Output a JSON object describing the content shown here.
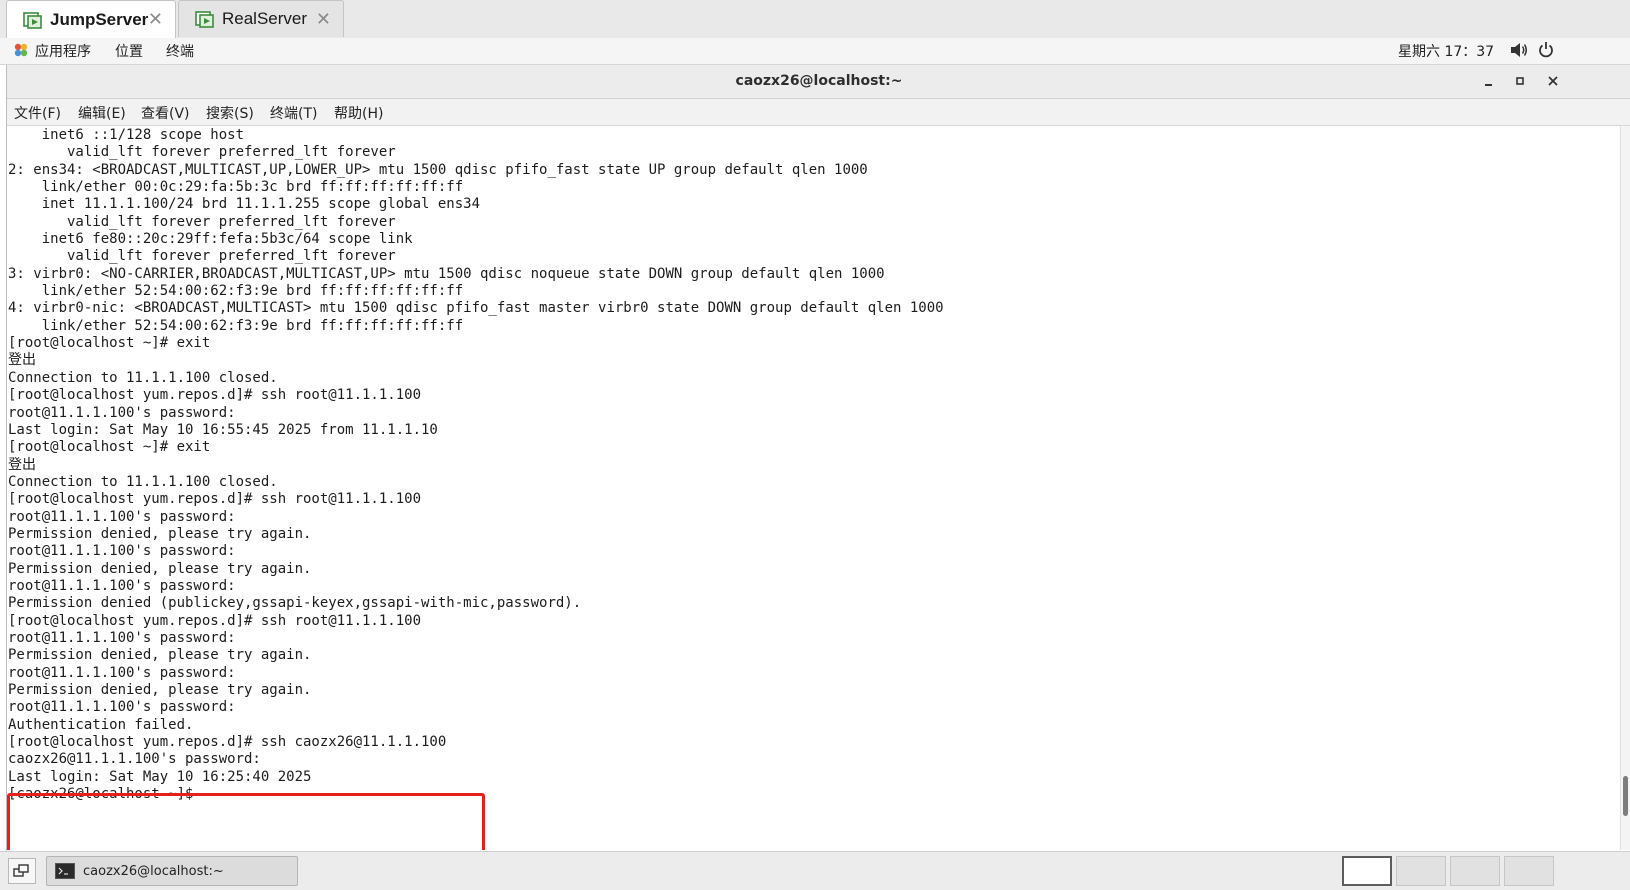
{
  "vm_tabs": [
    {
      "label": "JumpServer",
      "active": true
    },
    {
      "label": "RealServer",
      "active": false
    }
  ],
  "topbar": {
    "apps": "应用程序",
    "places": "位置",
    "terminal": "终端",
    "clock": "星期六 17：37"
  },
  "window": {
    "title": "caozx26@localhost:~"
  },
  "menu": [
    "文件(F)",
    "编辑(E)",
    "查看(V)",
    "搜索(S)",
    "终端(T)",
    "帮助(H)"
  ],
  "terminal": {
    "lines": [
      "    inet6 ::1/128 scope host ",
      "       valid_lft forever preferred_lft forever",
      "2: ens34: <BROADCAST,MULTICAST,UP,LOWER_UP> mtu 1500 qdisc pfifo_fast state UP group default qlen 1000",
      "    link/ether 00:0c:29:fa:5b:3c brd ff:ff:ff:ff:ff:ff",
      "    inet 11.1.1.100/24 brd 11.1.1.255 scope global ens34",
      "       valid_lft forever preferred_lft forever",
      "    inet6 fe80::20c:29ff:fefa:5b3c/64 scope link ",
      "       valid_lft forever preferred_lft forever",
      "3: virbr0: <NO-CARRIER,BROADCAST,MULTICAST,UP> mtu 1500 qdisc noqueue state DOWN group default qlen 1000",
      "    link/ether 52:54:00:62:f3:9e brd ff:ff:ff:ff:ff:ff",
      "4: virbr0-nic: <BROADCAST,MULTICAST> mtu 1500 qdisc pfifo_fast master virbr0 state DOWN group default qlen 1000",
      "    link/ether 52:54:00:62:f3:9e brd ff:ff:ff:ff:ff:ff",
      "[root@localhost ~]# exit",
      "登出",
      "Connection to 11.1.1.100 closed.",
      "[root@localhost yum.repos.d]# ssh root@11.1.1.100",
      "root@11.1.1.100's password: ",
      "Last login: Sat May 10 16:55:45 2025 from 11.1.1.10",
      "[root@localhost ~]# exit",
      "登出",
      "Connection to 11.1.1.100 closed.",
      "[root@localhost yum.repos.d]# ssh root@11.1.1.100",
      "root@11.1.1.100's password: ",
      "Permission denied, please try again.",
      "root@11.1.1.100's password: ",
      "Permission denied, please try again.",
      "root@11.1.1.100's password: ",
      "Permission denied (publickey,gssapi-keyex,gssapi-with-mic,password).",
      "[root@localhost yum.repos.d]# ssh root@11.1.1.100",
      "root@11.1.1.100's password: ",
      "Permission denied, please try again.",
      "root@11.1.1.100's password: ",
      "Permission denied, please try again.",
      "root@11.1.1.100's password: ",
      "Authentication failed.",
      "[root@localhost yum.repos.d]# ssh caozx26@11.1.1.100",
      "caozx26@11.1.1.100's password: ",
      "Last login: Sat May 10 16:25:40 2025",
      "[caozx26@localhost ~]$ "
    ]
  },
  "taskbar": {
    "task_label": "caozx26@localhost:~",
    "workspaces": 4,
    "active_workspace": 1
  },
  "colors": {
    "highlight_box": "#e8201c"
  }
}
